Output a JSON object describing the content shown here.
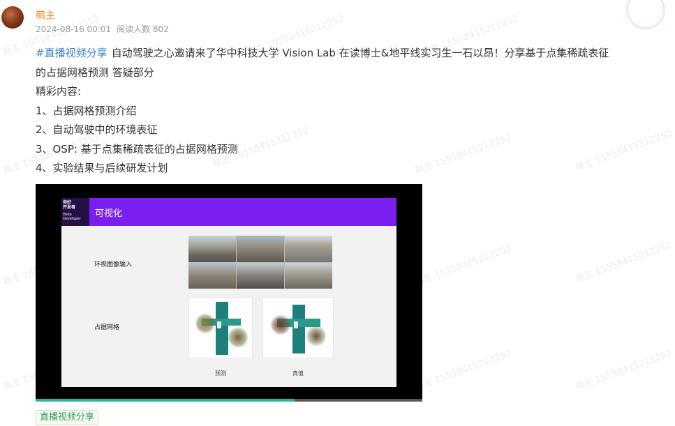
{
  "author": {
    "name": "萌主"
  },
  "post_meta": {
    "datetime": "2024-08-16 00:01",
    "reads": "阅读人数 802"
  },
  "post": {
    "hashtag": "#直播视频分享",
    "line1": "自动驾驶之心邀请来了华中科技大学 Vision Lab 在读博士&地平线实习生一石以昂！分享基于点集稀疏表征",
    "line2": "的占据网格预测 答疑部分",
    "line3": "精彩内容:",
    "item1": "1、占据网格预测介绍",
    "item2": "2、自动驾驶中的环境表征",
    "item3": "3、OSP: 基于点集稀疏表征的占据网格预测",
    "item4": "4、实验结果与后续研发计划"
  },
  "video": {
    "slide_title": "可视化",
    "logo_line1": "你好",
    "logo_line2": "开发者",
    "logo_line3": "Hello",
    "logo_line4": "Developer",
    "row1_label": "环视图像输入",
    "row2_label": "占据网格",
    "caption_pred": "预测",
    "caption_gt": "真值",
    "progress_fraction": 0.67,
    "progress_color": "#2db39e",
    "header_color": "#7a1ff0"
  },
  "tag_button": {
    "label": "直播视频分享"
  },
  "watermark_text": "萌主 15558415212252",
  "colors": {
    "username": "#f08a24",
    "hashtag": "#3d83c6",
    "tag": "#3a9a5a"
  }
}
